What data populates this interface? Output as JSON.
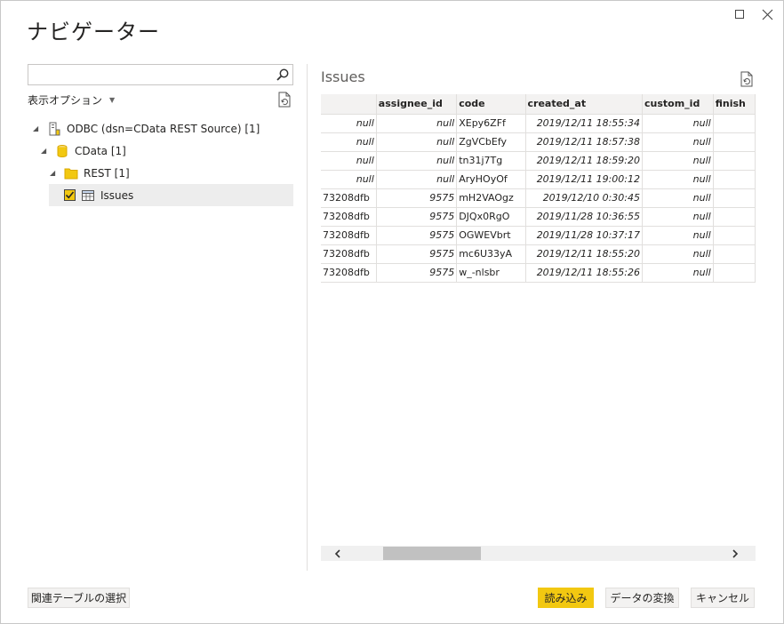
{
  "window": {
    "title": "ナビゲーター",
    "maximize_icon": "maximize-icon",
    "close_icon": "close-icon"
  },
  "left": {
    "search_placeholder": "",
    "display_options_label": "表示オプション",
    "tree": [
      {
        "label": "ODBC (dsn=CData REST Source) [1]",
        "icon": "server-icon",
        "expanded": true
      },
      {
        "label": "CData [1]",
        "icon": "database-icon",
        "expanded": true
      },
      {
        "label": "REST [1]",
        "icon": "folder-icon",
        "expanded": true
      },
      {
        "label": "Issues",
        "icon": "table-icon",
        "checked": true,
        "selected": true
      }
    ]
  },
  "preview": {
    "title": "Issues",
    "columns": [
      "",
      "assignee_id",
      "code",
      "created_at",
      "custom_id",
      "finish"
    ],
    "rows": [
      [
        "null",
        "null",
        "XEpy6ZFf",
        "2019/12/11 18:55:34",
        "null"
      ],
      [
        "null",
        "null",
        "ZgVCbEfy",
        "2019/12/11 18:57:38",
        "null"
      ],
      [
        "null",
        "null",
        "tn31j7Tg",
        "2019/12/11 18:59:20",
        "null"
      ],
      [
        "null",
        "null",
        "AryHOyOf",
        "2019/12/11 19:00:12",
        "null"
      ],
      [
        "73208dfb",
        "9575",
        "mH2VAOgz",
        "2019/12/10 0:30:45",
        "null"
      ],
      [
        "73208dfb",
        "9575",
        "DJQx0RgO",
        "2019/11/28 10:36:55",
        "null"
      ],
      [
        "73208dfb",
        "9575",
        "OGWEVbrt",
        "2019/11/28 10:37:17",
        "null"
      ],
      [
        "73208dfb",
        "9575",
        "mc6U33yA",
        "2019/12/11 18:55:20",
        "null"
      ],
      [
        "73208dfb",
        "9575",
        "w_-nlsbr",
        "2019/12/11 18:55:26",
        "null"
      ]
    ]
  },
  "buttons": {
    "related_tables": "関連テーブルの選択",
    "load": "読み込み",
    "transform": "データの変換",
    "cancel": "キャンセル"
  },
  "colors": {
    "accent": "#f2c811",
    "header_bg": "#f3f2f1"
  }
}
